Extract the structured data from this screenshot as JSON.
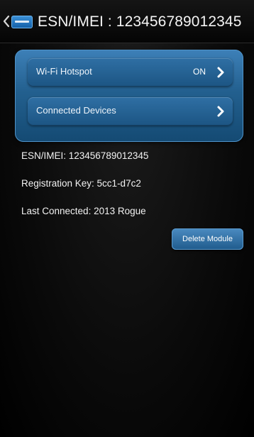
{
  "header": {
    "title": "ESN/IMEI : 123456789012345",
    "back_icon": "chevron-left-icon",
    "logo_icon": "app-logo-icon"
  },
  "settings": {
    "wifi_hotspot": {
      "label": "Wi-Fi Hotspot",
      "value": "ON",
      "icon": "chevron-right-icon"
    },
    "connected_devices": {
      "label": "Connected Devices",
      "icon": "chevron-right-icon"
    }
  },
  "info": {
    "esn": "ESN/IMEI: 123456789012345",
    "registration_key": "Registration Key: 5cc1-d7c2",
    "last_connected": "Last Connected: 2013 Rogue"
  },
  "actions": {
    "delete_module": "Delete Module"
  },
  "colors": {
    "panel_blue": "#23608f",
    "button_blue": "#3a7bb3",
    "background": "#000000"
  }
}
